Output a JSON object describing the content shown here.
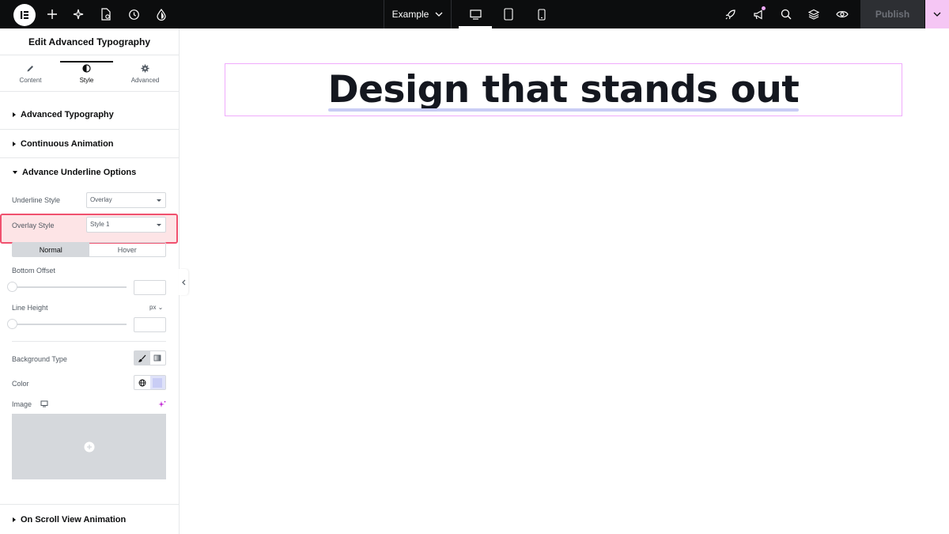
{
  "topbar": {
    "page_name": "Example",
    "publish_label": "Publish",
    "left_icons": [
      "elementor-logo-icon",
      "add-icon",
      "ai-sparkle-icon",
      "page-settings-icon",
      "history-icon",
      "site-settings-icon"
    ],
    "devices": [
      "desktop-icon",
      "tablet-icon",
      "mobile-icon"
    ],
    "active_device": "desktop",
    "right_icons": [
      "rocket-icon",
      "whats-new-icon",
      "search-icon",
      "structure-icon",
      "preview-icon"
    ]
  },
  "sidebar": {
    "title": "Edit Advanced Typography",
    "tabs": [
      {
        "label": "Content",
        "icon": "pencil-icon"
      },
      {
        "label": "Style",
        "icon": "half-circle-icon"
      },
      {
        "label": "Advanced",
        "icon": "gear-icon"
      }
    ],
    "active_tab": "Style",
    "sections": {
      "advanced_typography": "Advanced Typography",
      "continuous_animation": "Continuous Animation",
      "advance_underline": "Advance Underline Options",
      "on_scroll": "On Scroll View Animation"
    },
    "controls": {
      "underline_style_label": "Underline Style",
      "underline_style_value": "Overlay",
      "overlay_style_label": "Overlay Style",
      "overlay_style_value": "Style 1",
      "state_normal": "Normal",
      "state_hover": "Hover",
      "active_state": "Normal",
      "bottom_offset_label": "Bottom Offset",
      "line_height_label": "Line Height",
      "line_height_unit": "px",
      "background_type_label": "Background Type",
      "color_label": "Color",
      "image_label": "Image"
    }
  },
  "canvas": {
    "heading": "Design that stands out",
    "underline_color": "#c9cdf5"
  },
  "colors": {
    "topbar_bg": "#0c0d0e",
    "accent_pink": "#f0abfc",
    "highlight_red": "#f0506e"
  }
}
